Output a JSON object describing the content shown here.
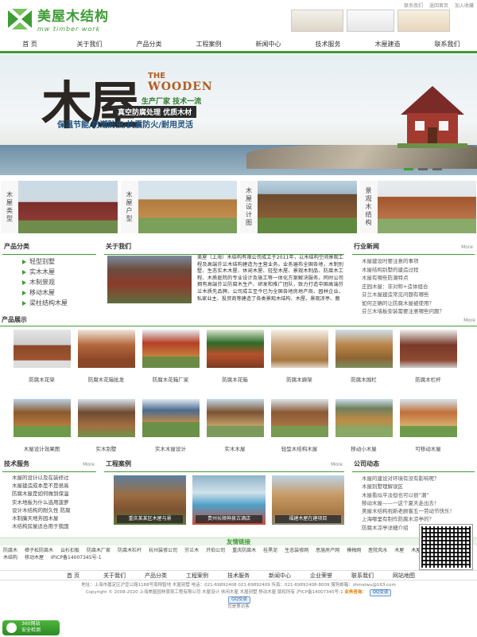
{
  "header": {
    "brand_cn": "美屋木结构",
    "brand_en": "mw timber work",
    "top_links": [
      "联系我们",
      "返回首页",
      "加入收藏"
    ]
  },
  "nav": [
    "首 页",
    "关于我们",
    "产品分类",
    "工程案例",
    "新闻中心",
    "技术服务",
    "木屋建造",
    "联系我们"
  ],
  "banner": {
    "big": "木屋",
    "the": "THE",
    "wooden": "WOODEN",
    "slogan1": "生产厂家 技术一流",
    "slogan2": "真空防腐处理 优质木材",
    "slogan3": "保温节能/防潮防虫/抗震防火/耐用灵活"
  },
  "categories": [
    {
      "label": "木屋类型"
    },
    {
      "label": "木屋户型"
    },
    {
      "label": "木屋设计图"
    },
    {
      "label": "景观木结构"
    }
  ],
  "product_cat": {
    "title": "产品分类",
    "items": [
      "轻型别墅",
      "实木木屋",
      "木制景观",
      "移动木屋",
      "梁柱结构木屋"
    ]
  },
  "about": {
    "title": "关于我们",
    "text": "美屋（上海）木结构有限公司成立于2011年，以木结构空间景观工程及高端芬兰木结构建造为主营业务。业务遍布全国各地，木制别墅、生态实木木屋、休闲木屋、轻型木屋、景观木制品、防腐木工程、木质庭院的专业设计及施工等一体化方案解决服务。同时公司拥有高端芬兰防腐木生产、研发和推广团队，致力打造中国高端芬兰木质先品牌。公司成立至今已为全国各地房地产商、园林企业、私家业主、投资商等建造了各类景观木结构、木屋、景观凉亭、葡"
  },
  "news": {
    "title": "行业新闻",
    "more": "More",
    "items": [
      "木屋建设时要注意的事项",
      "木屋结构别墅的建造过程",
      "木屋有哪些防潮特点",
      "庄园木屋：非对称+造体组合",
      "芬兰木屋建造常见问题有哪些",
      "如何正确的让防腐木屋被使用？",
      "芬兰木墙板安装需要注意哪些问题？"
    ]
  },
  "products": {
    "title": "产品展示",
    "more": "More",
    "items": [
      "防腐木花架",
      "防腐木花箱批发",
      "防腐木花箱厂家",
      "防腐木花箱",
      "防腐木廊架",
      "防腐木围栏",
      "防腐木栏杆",
      "木屋设计效果图",
      "实木别墅",
      "实木木屋设计",
      "实木木屋",
      "轻型木结构木屋",
      "移动小木屋",
      "可移动木屋"
    ]
  },
  "tech": {
    "title": "技术服务",
    "more": "More",
    "items": [
      "木屋的设计以及在装修过",
      "木屋建造成本是不是很高",
      "防腐木屋是如何做到保温",
      "实木地板为什么选用菠萝",
      "设计木结构的耐久性 防腐",
      "木制廉天地芳园木屋",
      "木结构房屋适合用于我国"
    ]
  },
  "cases": {
    "title": "工程案例",
    "more": "More",
    "items": [
      "重庆某某区木屋与景",
      "贵州长顺神泉古酒店",
      "福建木屋在建项目"
    ]
  },
  "dynamics": {
    "title": "公司动态",
    "items": [
      "木屋的建设对环境有没有影响呢？",
      "木屋别墅理解误区",
      "木屋看似平淡但也可以很“潮”",
      "移动木屋——一这个夏天走出去！",
      "美屋木结构祝新老顾客五一劳动节快乐！",
      "上海哪里有制作防腐木凉亭的？",
      "防腐木凉亭详细介绍"
    ]
  },
  "friend_links": {
    "title": "友情链接",
    "items": [
      "防腐木",
      "樟子松防腐木",
      "云杉扣板",
      "防腐木厂家",
      "防腐木栏杆",
      "杭州装修公司",
      "芬兰木",
      "开伯公司",
      "重庆防腐木",
      "桂黑泥",
      "生态装修网",
      "思施房产网",
      "模梅网",
      "医院风水",
      "木屋",
      "木屋厂家",
      "集成墙面",
      "我的木结构",
      "移动木屋",
      "IPICP备14007345号-1"
    ]
  },
  "footer_nav": [
    "首 页",
    "关于我们",
    "产品分类",
    "工程案例",
    "技术服务",
    "新闻中心",
    "企业荣誉",
    "联系我们",
    "网站地图"
  ],
  "footer": {
    "address": "地址：上海市嘉定区沪宜公路1188号南翔智地 木屋别墅  电话：021-69892408  021-69892409  传真：021-69892408-8009  服务邮箱：zhmeiwu@163.com",
    "copyright": "Copyright © 2008-2020 上海美屋园林景观工程有限公司 木屋设计 休闲木屋 木屋别墅 移动木屋 版权所有 沪ICP备14007345号-1",
    "hotline_label": "业务咨询：",
    "qq": "QQ交谈",
    "visits": "您是第访客"
  },
  "badge": {
    "line1": "360网站",
    "line2": "安全检测"
  },
  "colors": {
    "accent": "#3f9c35"
  }
}
